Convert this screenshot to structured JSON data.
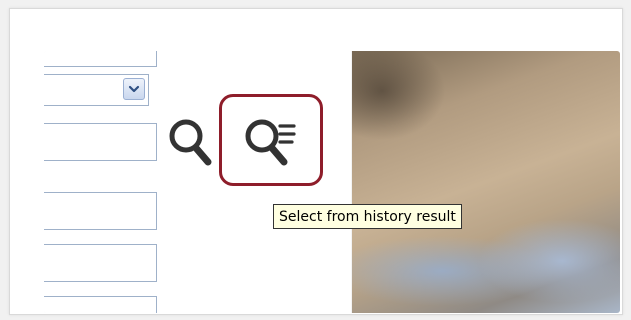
{
  "toolbar": {
    "search_icon": "search-icon",
    "history_search_icon": "search-history-icon",
    "highlight_color": "#8e1d2a"
  },
  "form": {
    "dropdown_icon": "chevron-down-icon"
  },
  "tooltip": {
    "text": "Select from history result"
  }
}
